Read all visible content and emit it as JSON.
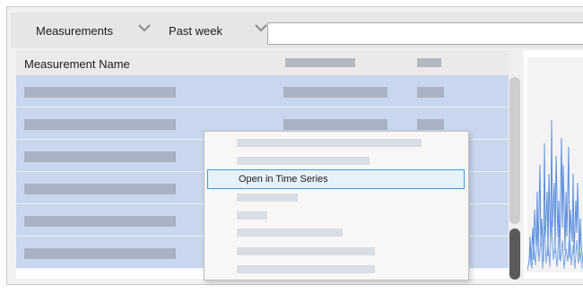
{
  "toolbar": {
    "measurements_label": "Measurements",
    "period_label": "Past week",
    "search_value": ""
  },
  "table": {
    "columns": {
      "name": "Measurement Name"
    },
    "rows": [
      {},
      {},
      {},
      {},
      {},
      {}
    ]
  },
  "context_menu": {
    "items": [
      {
        "label": ""
      },
      {
        "label": ""
      },
      {
        "label": "Open in Time Series",
        "highlighted": true
      },
      {
        "label": ""
      },
      {
        "label": ""
      },
      {
        "label": ""
      },
      {
        "label": ""
      },
      {
        "label": ""
      }
    ]
  },
  "colors": {
    "selection": "#c9d7ee",
    "menu_highlight": "#e6f2fb",
    "menu_highlight_border": "#3d9ad8",
    "chart_line": "#5b8fe0",
    "scroll_thumb": "#5a5a5a",
    "placeholder": "#a9b2c4"
  },
  "icons": {
    "dropdown": "chevron-down-icon"
  }
}
